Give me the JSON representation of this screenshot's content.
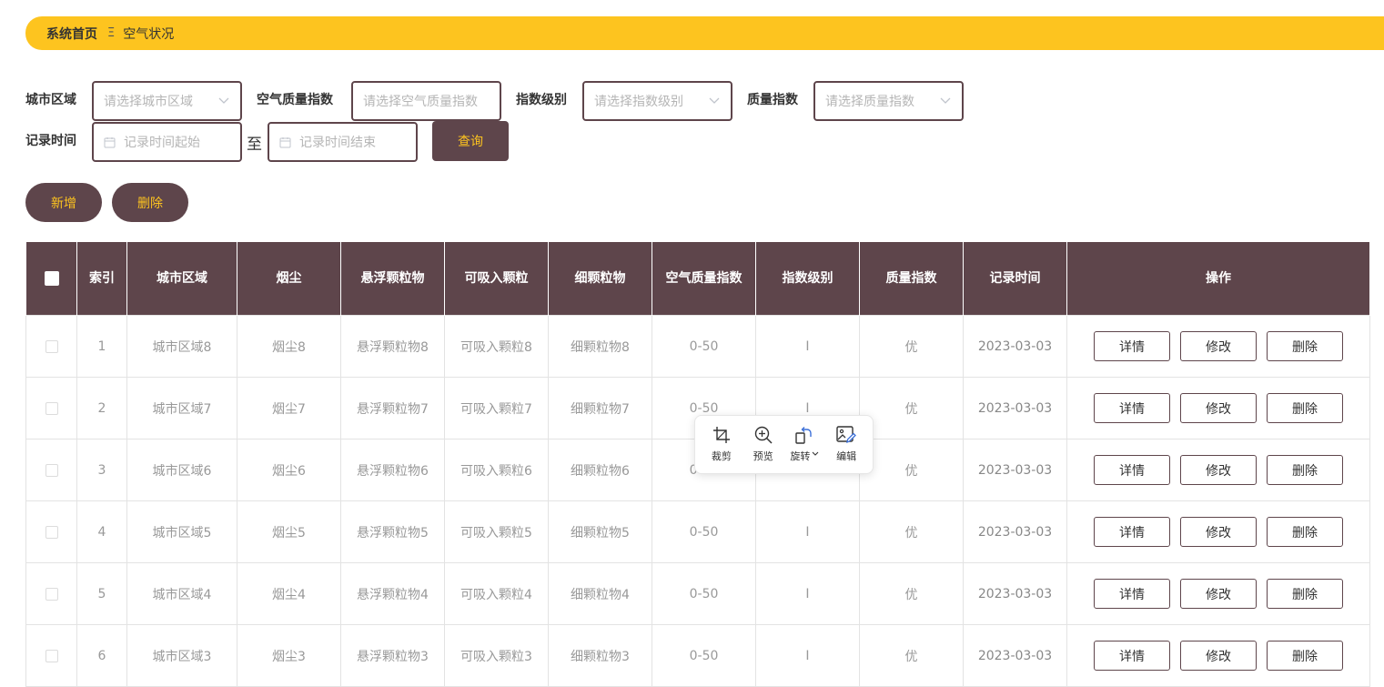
{
  "breadcrumb": {
    "home": "系统首页",
    "separator": "Ξ",
    "current": "空气状况"
  },
  "search": {
    "city_label": "城市区域",
    "city_placeholder": "请选择城市区域",
    "aqi_label": "空气质量指数",
    "aqi_placeholder": "请选择空气质量指数",
    "level_label": "指数级别",
    "level_placeholder": "请选择指数级别",
    "quality_label": "质量指数",
    "quality_placeholder": "请选择质量指数",
    "time_label": "记录时间",
    "time_start_placeholder": "记录时间起始",
    "time_to": "至",
    "time_end_placeholder": "记录时间结束",
    "query_button": "查询"
  },
  "actions": {
    "add": "新增",
    "delete": "删除"
  },
  "table": {
    "headers": [
      "索引",
      "城市区域",
      "烟尘",
      "悬浮颗粒物",
      "可吸入颗粒",
      "细颗粒物",
      "空气质量指数",
      "指数级别",
      "质量指数",
      "记录时间",
      "操作"
    ],
    "rows": [
      [
        "1",
        "城市区域8",
        "烟尘8",
        "悬浮颗粒物8",
        "可吸入颗粒8",
        "细颗粒物8",
        "0-50",
        "I",
        "优",
        "2023-03-03"
      ],
      [
        "2",
        "城市区域7",
        "烟尘7",
        "悬浮颗粒物7",
        "可吸入颗粒7",
        "细颗粒物7",
        "0-50",
        "I",
        "优",
        "2023-03-03"
      ],
      [
        "3",
        "城市区域6",
        "烟尘6",
        "悬浮颗粒物6",
        "可吸入颗粒6",
        "细颗粒物6",
        "0-50",
        "I",
        "优",
        "2023-03-03"
      ],
      [
        "4",
        "城市区域5",
        "烟尘5",
        "悬浮颗粒物5",
        "可吸入颗粒5",
        "细颗粒物5",
        "0-50",
        "I",
        "优",
        "2023-03-03"
      ],
      [
        "5",
        "城市区域4",
        "烟尘4",
        "悬浮颗粒物4",
        "可吸入颗粒4",
        "细颗粒物4",
        "0-50",
        "I",
        "优",
        "2023-03-03"
      ],
      [
        "6",
        "城市区域3",
        "烟尘3",
        "悬浮颗粒物3",
        "可吸入颗粒3",
        "细颗粒物3",
        "0-50",
        "I",
        "优",
        "2023-03-03"
      ]
    ],
    "row_actions": {
      "detail": "详情",
      "edit": "修改",
      "delete": "删除"
    }
  },
  "image_toolbar": {
    "crop": "裁剪",
    "preview": "预览",
    "rotate": "旋转",
    "edit": "编辑"
  },
  "colors": {
    "accent": "#fdc41f",
    "primary": "#5e454b"
  },
  "icons": [
    "chevron-down-icon",
    "calendar-icon",
    "crop-icon",
    "zoom-in-icon",
    "rotate-icon",
    "image-edit-icon"
  ]
}
